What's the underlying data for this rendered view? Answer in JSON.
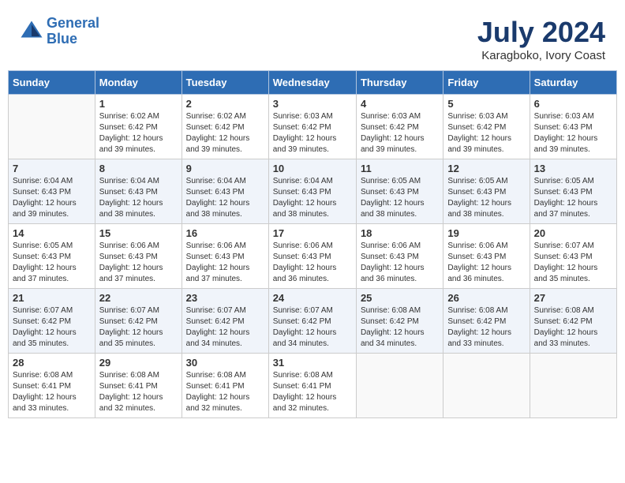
{
  "header": {
    "logo_line1": "General",
    "logo_line2": "Blue",
    "month_year": "July 2024",
    "location": "Karagboko, Ivory Coast"
  },
  "weekdays": [
    "Sunday",
    "Monday",
    "Tuesday",
    "Wednesday",
    "Thursday",
    "Friday",
    "Saturday"
  ],
  "weeks": [
    [
      {
        "day": "",
        "info": ""
      },
      {
        "day": "1",
        "info": "Sunrise: 6:02 AM\nSunset: 6:42 PM\nDaylight: 12 hours\nand 39 minutes."
      },
      {
        "day": "2",
        "info": "Sunrise: 6:02 AM\nSunset: 6:42 PM\nDaylight: 12 hours\nand 39 minutes."
      },
      {
        "day": "3",
        "info": "Sunrise: 6:03 AM\nSunset: 6:42 PM\nDaylight: 12 hours\nand 39 minutes."
      },
      {
        "day": "4",
        "info": "Sunrise: 6:03 AM\nSunset: 6:42 PM\nDaylight: 12 hours\nand 39 minutes."
      },
      {
        "day": "5",
        "info": "Sunrise: 6:03 AM\nSunset: 6:42 PM\nDaylight: 12 hours\nand 39 minutes."
      },
      {
        "day": "6",
        "info": "Sunrise: 6:03 AM\nSunset: 6:43 PM\nDaylight: 12 hours\nand 39 minutes."
      }
    ],
    [
      {
        "day": "7",
        "info": "Sunrise: 6:04 AM\nSunset: 6:43 PM\nDaylight: 12 hours\nand 39 minutes."
      },
      {
        "day": "8",
        "info": "Sunrise: 6:04 AM\nSunset: 6:43 PM\nDaylight: 12 hours\nand 38 minutes."
      },
      {
        "day": "9",
        "info": "Sunrise: 6:04 AM\nSunset: 6:43 PM\nDaylight: 12 hours\nand 38 minutes."
      },
      {
        "day": "10",
        "info": "Sunrise: 6:04 AM\nSunset: 6:43 PM\nDaylight: 12 hours\nand 38 minutes."
      },
      {
        "day": "11",
        "info": "Sunrise: 6:05 AM\nSunset: 6:43 PM\nDaylight: 12 hours\nand 38 minutes."
      },
      {
        "day": "12",
        "info": "Sunrise: 6:05 AM\nSunset: 6:43 PM\nDaylight: 12 hours\nand 38 minutes."
      },
      {
        "day": "13",
        "info": "Sunrise: 6:05 AM\nSunset: 6:43 PM\nDaylight: 12 hours\nand 37 minutes."
      }
    ],
    [
      {
        "day": "14",
        "info": "Sunrise: 6:05 AM\nSunset: 6:43 PM\nDaylight: 12 hours\nand 37 minutes."
      },
      {
        "day": "15",
        "info": "Sunrise: 6:06 AM\nSunset: 6:43 PM\nDaylight: 12 hours\nand 37 minutes."
      },
      {
        "day": "16",
        "info": "Sunrise: 6:06 AM\nSunset: 6:43 PM\nDaylight: 12 hours\nand 37 minutes."
      },
      {
        "day": "17",
        "info": "Sunrise: 6:06 AM\nSunset: 6:43 PM\nDaylight: 12 hours\nand 36 minutes."
      },
      {
        "day": "18",
        "info": "Sunrise: 6:06 AM\nSunset: 6:43 PM\nDaylight: 12 hours\nand 36 minutes."
      },
      {
        "day": "19",
        "info": "Sunrise: 6:06 AM\nSunset: 6:43 PM\nDaylight: 12 hours\nand 36 minutes."
      },
      {
        "day": "20",
        "info": "Sunrise: 6:07 AM\nSunset: 6:43 PM\nDaylight: 12 hours\nand 35 minutes."
      }
    ],
    [
      {
        "day": "21",
        "info": "Sunrise: 6:07 AM\nSunset: 6:42 PM\nDaylight: 12 hours\nand 35 minutes."
      },
      {
        "day": "22",
        "info": "Sunrise: 6:07 AM\nSunset: 6:42 PM\nDaylight: 12 hours\nand 35 minutes."
      },
      {
        "day": "23",
        "info": "Sunrise: 6:07 AM\nSunset: 6:42 PM\nDaylight: 12 hours\nand 34 minutes."
      },
      {
        "day": "24",
        "info": "Sunrise: 6:07 AM\nSunset: 6:42 PM\nDaylight: 12 hours\nand 34 minutes."
      },
      {
        "day": "25",
        "info": "Sunrise: 6:08 AM\nSunset: 6:42 PM\nDaylight: 12 hours\nand 34 minutes."
      },
      {
        "day": "26",
        "info": "Sunrise: 6:08 AM\nSunset: 6:42 PM\nDaylight: 12 hours\nand 33 minutes."
      },
      {
        "day": "27",
        "info": "Sunrise: 6:08 AM\nSunset: 6:42 PM\nDaylight: 12 hours\nand 33 minutes."
      }
    ],
    [
      {
        "day": "28",
        "info": "Sunrise: 6:08 AM\nSunset: 6:41 PM\nDaylight: 12 hours\nand 33 minutes."
      },
      {
        "day": "29",
        "info": "Sunrise: 6:08 AM\nSunset: 6:41 PM\nDaylight: 12 hours\nand 32 minutes."
      },
      {
        "day": "30",
        "info": "Sunrise: 6:08 AM\nSunset: 6:41 PM\nDaylight: 12 hours\nand 32 minutes."
      },
      {
        "day": "31",
        "info": "Sunrise: 6:08 AM\nSunset: 6:41 PM\nDaylight: 12 hours\nand 32 minutes."
      },
      {
        "day": "",
        "info": ""
      },
      {
        "day": "",
        "info": ""
      },
      {
        "day": "",
        "info": ""
      }
    ]
  ]
}
